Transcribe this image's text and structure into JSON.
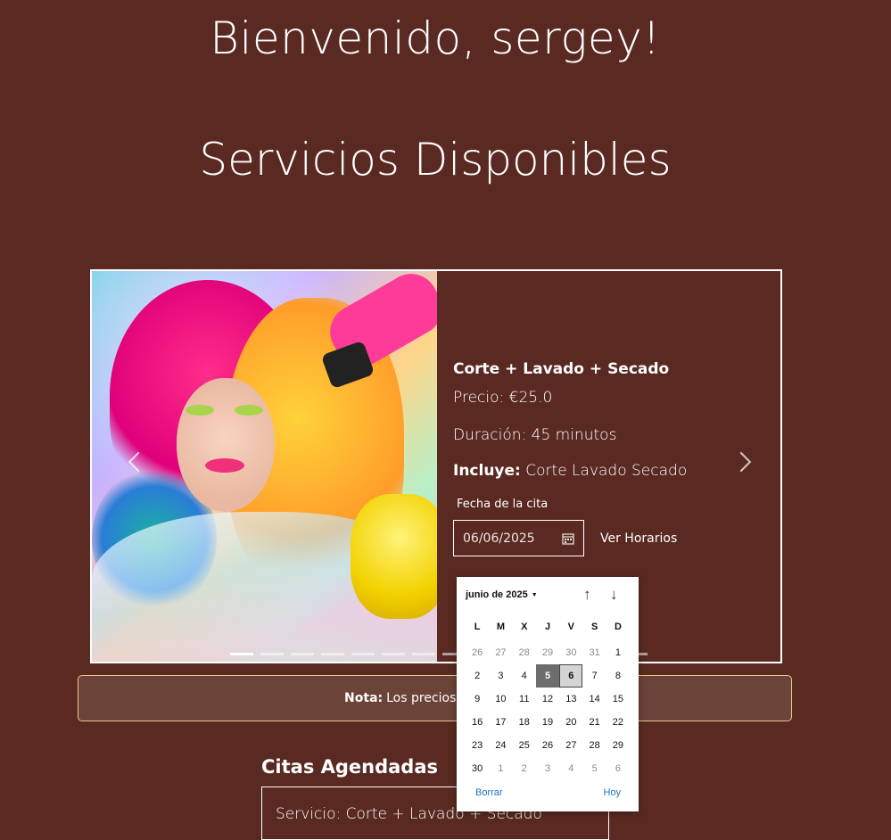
{
  "header": {
    "greeting": "Bienvenido, sergey!",
    "section_title": "Servicios Disponibles"
  },
  "service": {
    "name": "Corte + Lavado + Secado",
    "price": "Precio: €25.0",
    "duration": "Duración: 45 minutos",
    "includes_label": "Incluye:",
    "includes_value": "Corte Lavado Secado",
    "date_label": "Fecha de la cita",
    "date_value": "06/06/2025",
    "ver_horarios": "Ver Horarios",
    "image_icon": "hair-salon-photo"
  },
  "nota": {
    "label": "Nota:",
    "text": "Los precios pueden es"
  },
  "citas": {
    "title": "Citas Agendadas",
    "first_service": "Servicio: Corte + Lavado + Secado"
  },
  "datepicker": {
    "month": "junio de 2025",
    "weekdays": [
      "L",
      "M",
      "X",
      "J",
      "V",
      "S",
      "D"
    ],
    "days": [
      [
        "26",
        "27",
        "28",
        "29",
        "30",
        "31",
        "1"
      ],
      [
        "2",
        "3",
        "4",
        "5",
        "6",
        "7",
        "8"
      ],
      [
        "9",
        "10",
        "11",
        "12",
        "13",
        "14",
        "15"
      ],
      [
        "16",
        "17",
        "18",
        "19",
        "20",
        "21",
        "22"
      ],
      [
        "23",
        "24",
        "25",
        "26",
        "27",
        "28",
        "29"
      ],
      [
        "30",
        "1",
        "2",
        "3",
        "4",
        "5",
        "6"
      ]
    ],
    "selected_day": "5",
    "today": "6",
    "clear": "Borrar",
    "today_button": "Hoy"
  },
  "colors": {
    "background": "#5a2a22",
    "nota_border": "#e8c98a",
    "link": "#1a73c6"
  }
}
